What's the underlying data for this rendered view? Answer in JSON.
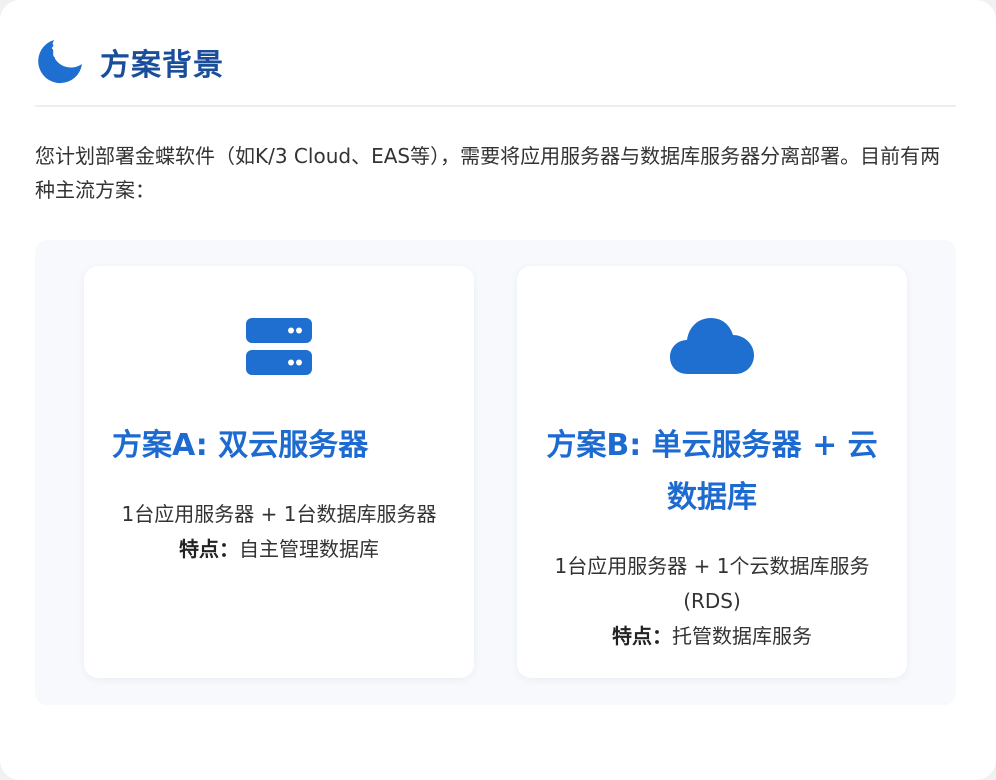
{
  "header": {
    "icon": "info-moon-icon",
    "title": "方案背景"
  },
  "intro": {
    "text": "您计划部署金蝶软件（如K/3 Cloud、EAS等），需要将应用服务器与数据库服务器分离部署。目前有两种主流方案："
  },
  "options": [
    {
      "icon": "server-icon",
      "title": "方案A: 双云服务器",
      "description": "1台应用服务器 + 1台数据库服务器",
      "feature_label": "特点：",
      "feature_value": "自主管理数据库"
    },
    {
      "icon": "cloud-icon",
      "title": "方案B: 单云服务器 + 云数据库",
      "description": "1台应用服务器 + 1个云数据库服务 (RDS)",
      "feature_label": "特点：",
      "feature_value": "托管数据库服务"
    }
  ],
  "colors": {
    "header_title": "#1a4e9a",
    "accent": "#1d6ad0",
    "icon_blue": "#1f6fd1"
  }
}
